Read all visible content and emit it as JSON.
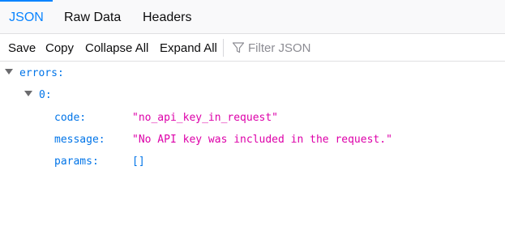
{
  "tabs": [
    {
      "label": "JSON",
      "active": true
    },
    {
      "label": "Raw Data",
      "active": false
    },
    {
      "label": "Headers",
      "active": false
    }
  ],
  "toolbar": {
    "save_label": "Save",
    "copy_label": "Copy",
    "collapse_all_label": "Collapse All",
    "expand_all_label": "Expand All",
    "filter_placeholder": "Filter JSON",
    "filter_icon": "funnel-icon"
  },
  "tree": {
    "root_key": "errors:",
    "item_key": "0:",
    "fields": [
      {
        "key": "code:",
        "value": "\"no_api_key_in_request\""
      },
      {
        "key": "message:",
        "value": "\"No API key was included in the request.\""
      },
      {
        "key": "params:",
        "value": "[]"
      }
    ]
  },
  "colors": {
    "accent": "#0a84ff",
    "key": "#0074e8",
    "string": "#dd00a9"
  }
}
